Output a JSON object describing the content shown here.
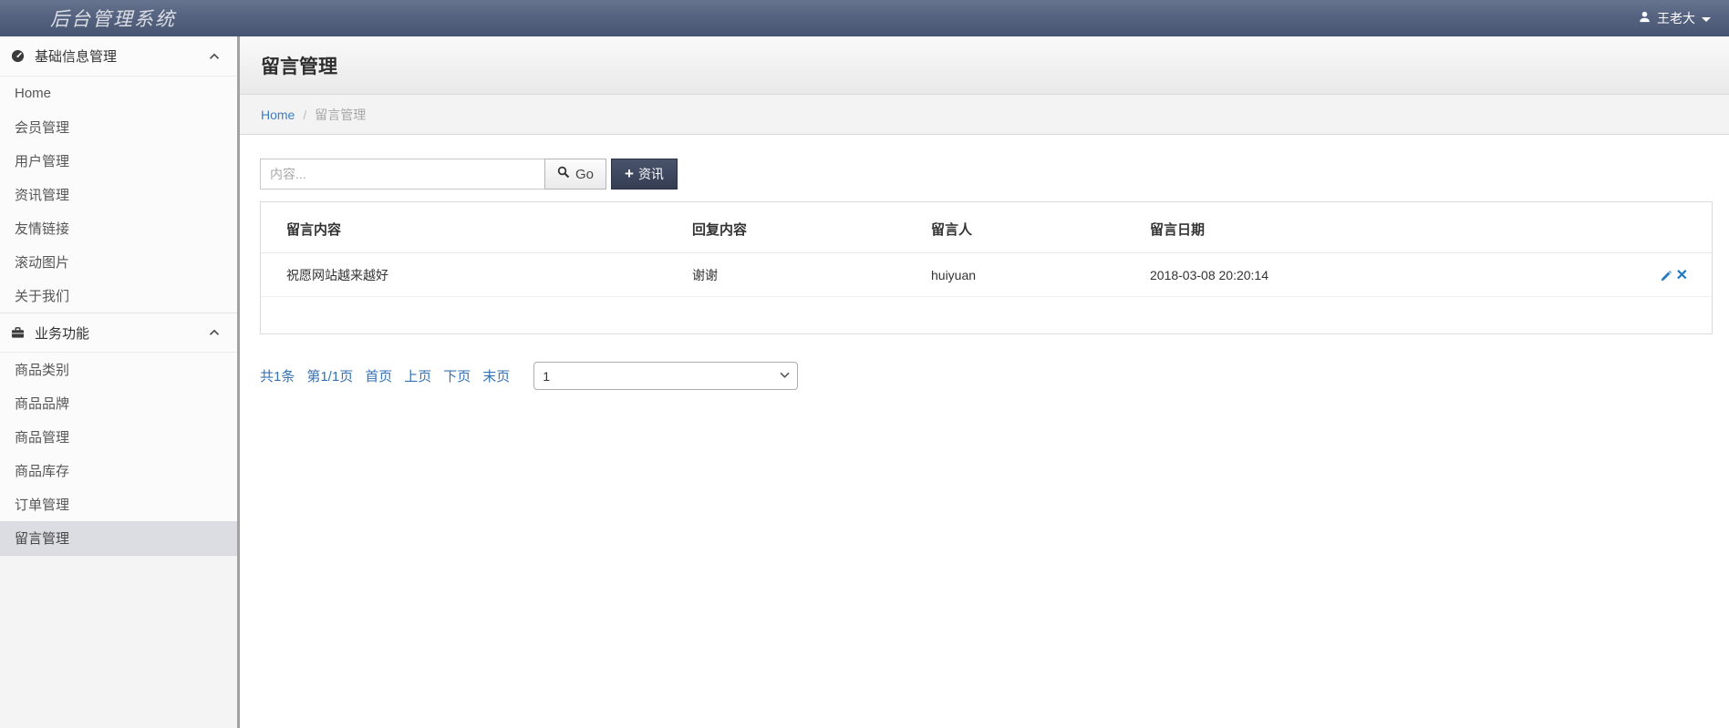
{
  "app": {
    "title": "后台管理系统"
  },
  "header": {
    "user": {
      "name": "王老大"
    }
  },
  "sidebar": {
    "sections": [
      {
        "label": "基础信息管理",
        "items": [
          {
            "label": "Home"
          },
          {
            "label": "会员管理"
          },
          {
            "label": "用户管理"
          },
          {
            "label": "资讯管理"
          },
          {
            "label": "友情链接"
          },
          {
            "label": "滚动图片"
          },
          {
            "label": "关于我们"
          }
        ]
      },
      {
        "label": "业务功能",
        "items": [
          {
            "label": "商品类别"
          },
          {
            "label": "商品品牌"
          },
          {
            "label": "商品管理"
          },
          {
            "label": "商品库存"
          },
          {
            "label": "订单管理"
          },
          {
            "label": "留言管理",
            "active": true
          }
        ]
      }
    ]
  },
  "main": {
    "page_title": "留言管理",
    "breadcrumb": {
      "home": "Home",
      "separator": "/",
      "current": "留言管理"
    },
    "toolbar": {
      "search_placeholder": "内容...",
      "go_label": "Go",
      "add_label": "资讯"
    },
    "table": {
      "columns": [
        "留言内容",
        "回复内容",
        "留言人",
        "留言日期"
      ],
      "rows": [
        {
          "content": "祝愿网站越来越好",
          "reply": "谢谢",
          "author": "huiyuan",
          "date": "2018-03-08 20:20:14"
        }
      ]
    },
    "pagination": {
      "total": "共1条",
      "page": "第1/1页",
      "first": "首页",
      "prev": "上页",
      "next": "下页",
      "last": "末页",
      "select_value": "1"
    }
  },
  "colors": {
    "topbar_gradient_top": "#66748f",
    "topbar_gradient_bottom": "#475571",
    "sidebar_active_bg": "#dcdce3",
    "link_blue": "#3472b5",
    "add_button_bg": "#3d465b",
    "action_icon_blue": "#1d78c1"
  }
}
